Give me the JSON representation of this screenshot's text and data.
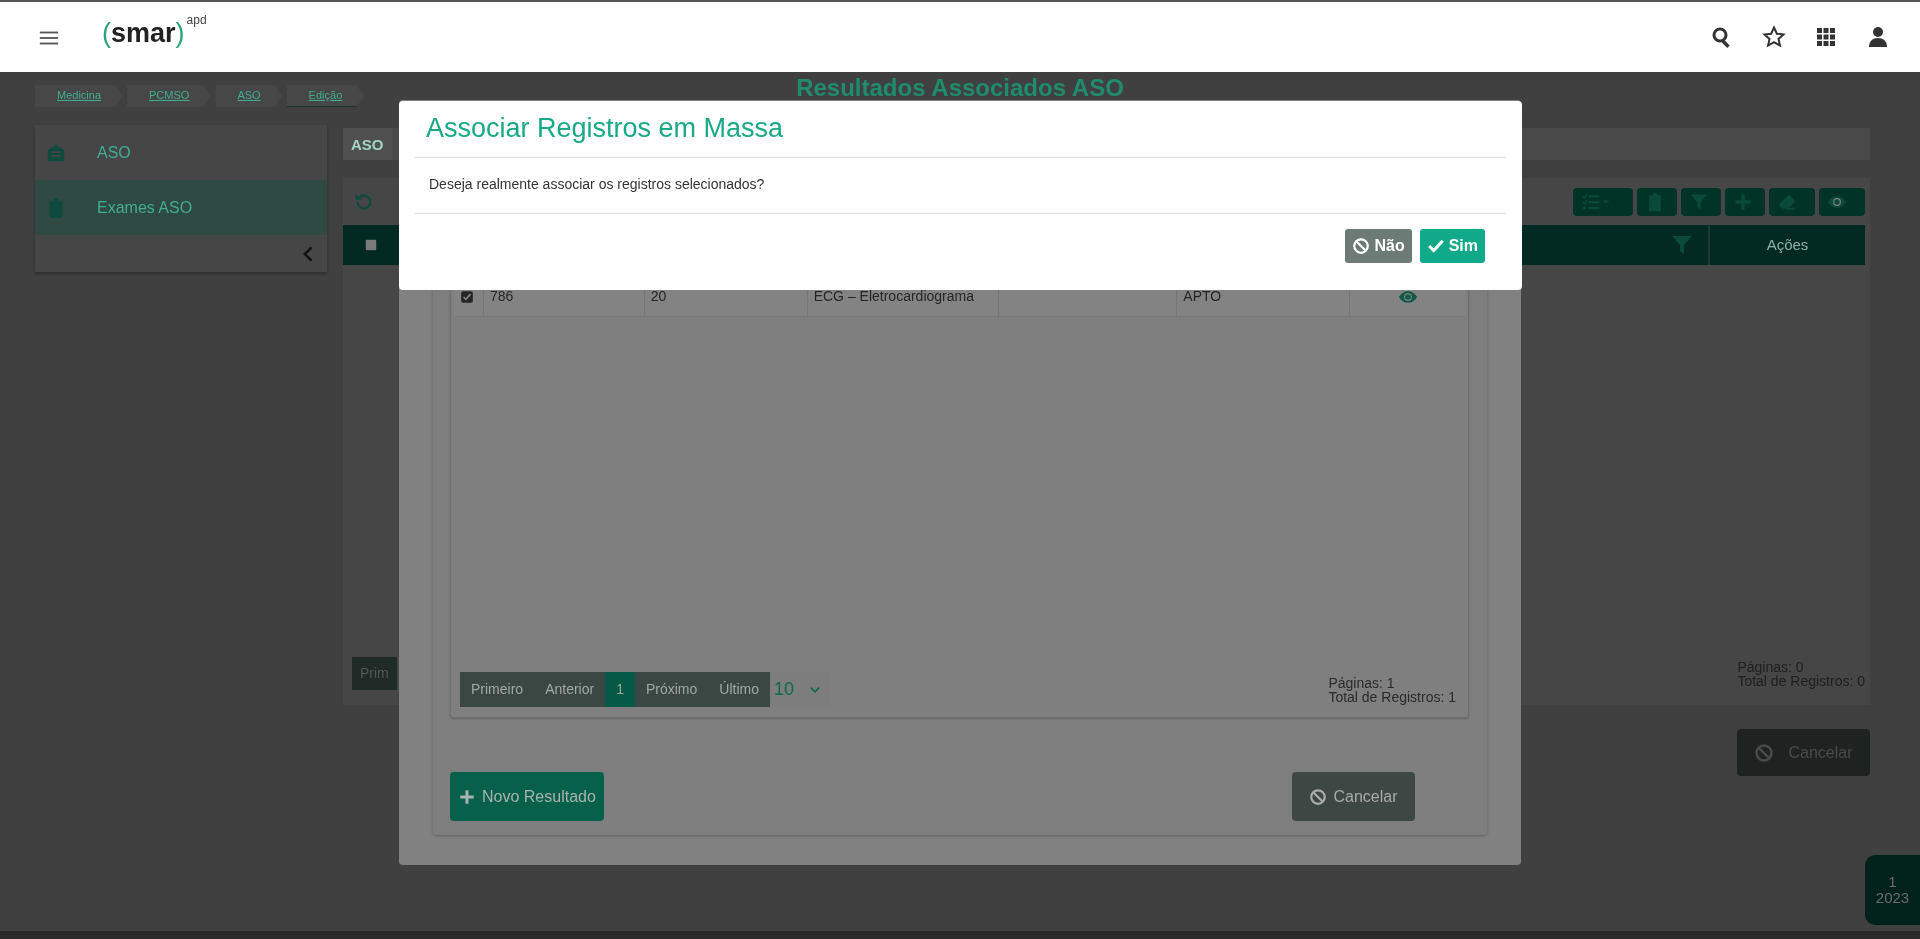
{
  "header": {
    "logo": {
      "open": "(",
      "name": "smar",
      "close": ")",
      "suffix": "apd"
    },
    "actions": [
      {
        "kind": "search"
      },
      {
        "kind": "star"
      },
      {
        "kind": "apps"
      },
      {
        "kind": "user"
      }
    ]
  },
  "breadcrumb": [
    {
      "label": "Medicina",
      "selected": false
    },
    {
      "label": "PCMSO",
      "selected": false
    },
    {
      "label": "ASO",
      "selected": false
    },
    {
      "label": "Edição",
      "selected": true
    }
  ],
  "page_title": "Resultados Associados ASO",
  "sidebar": {
    "items": [
      {
        "label": "ASO",
        "kind": "badge",
        "selected": false
      },
      {
        "label": "Exames ASO",
        "kind": "clipboard",
        "selected": true
      }
    ]
  },
  "main": {
    "tab": "ASO",
    "toolbar": [
      {
        "kind": "checklist"
      },
      {
        "kind": "clipboard"
      },
      {
        "kind": "filter"
      },
      {
        "kind": "plus"
      },
      {
        "kind": "eraser"
      },
      {
        "kind": "eye"
      }
    ],
    "table": {
      "select_all": {
        "checked": false
      },
      "columns": [
        {
          "label": "Ações"
        }
      ]
    },
    "pager_first": "Prim",
    "pages": "Páginas: 0",
    "total": "Total de Registros: 0",
    "cancel": "Cancelar"
  },
  "modal": {
    "rows": [
      {
        "checked": true,
        "column_1": "786",
        "column_2": "20",
        "column_3": "ECG – Eletrocardiograma",
        "column_5": "APTO"
      }
    ],
    "pagination": [
      {
        "label": "Primeiro",
        "selected": false
      },
      {
        "label": "Anterior",
        "selected": false
      },
      {
        "label": "1",
        "selected": true
      },
      {
        "label": "Próximo",
        "selected": false
      },
      {
        "label": "Último",
        "selected": false
      }
    ],
    "page_size": "10",
    "pages": "Páginas: 1",
    "total": "Total de Registros: 1",
    "buttons": [
      {
        "label": "Novo Resultado",
        "kind": "add"
      },
      {
        "label": "Cancelar",
        "kind": "cancel"
      }
    ]
  },
  "dialog": {
    "title": "Associar Registros em Massa",
    "message": "Deseja realmente associar os registros selecionados?",
    "buttons": [
      {
        "label": "Não",
        "kind": "no"
      },
      {
        "label": "Sim",
        "kind": "yes"
      }
    ]
  },
  "corner_badge": [
    "1",
    "2023"
  ]
}
